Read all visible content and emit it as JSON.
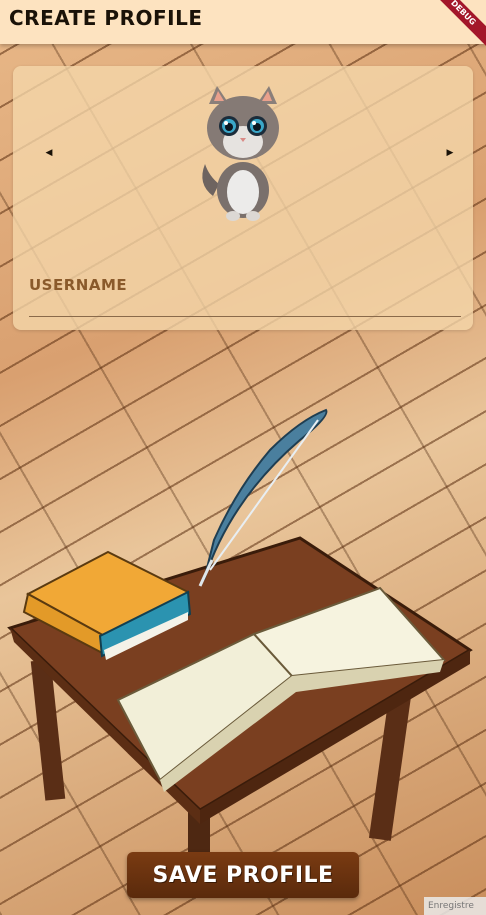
{
  "appbar": {
    "title": "CREATE PROFILE",
    "debug_badge": "DEBUG"
  },
  "profile_card": {
    "prev_avatar_icon": "chevron-left-icon",
    "next_avatar_icon": "chevron-right-icon",
    "avatar_icon": "cat-avatar-icon",
    "username_label": "USERNAME",
    "username_value": ""
  },
  "scene": {
    "icons": [
      "quill-feather-icon",
      "closed-book-icon",
      "open-book-icon",
      "wooden-table-icon"
    ]
  },
  "save_button": {
    "label": "SAVE PROFILE"
  },
  "corner_tag": "Enregistre",
  "colors": {
    "appbar_bg": "#fde3c0",
    "label_brown": "#8a5a2b",
    "button_brown": "#6b3210",
    "debug_red": "#a3162a"
  }
}
